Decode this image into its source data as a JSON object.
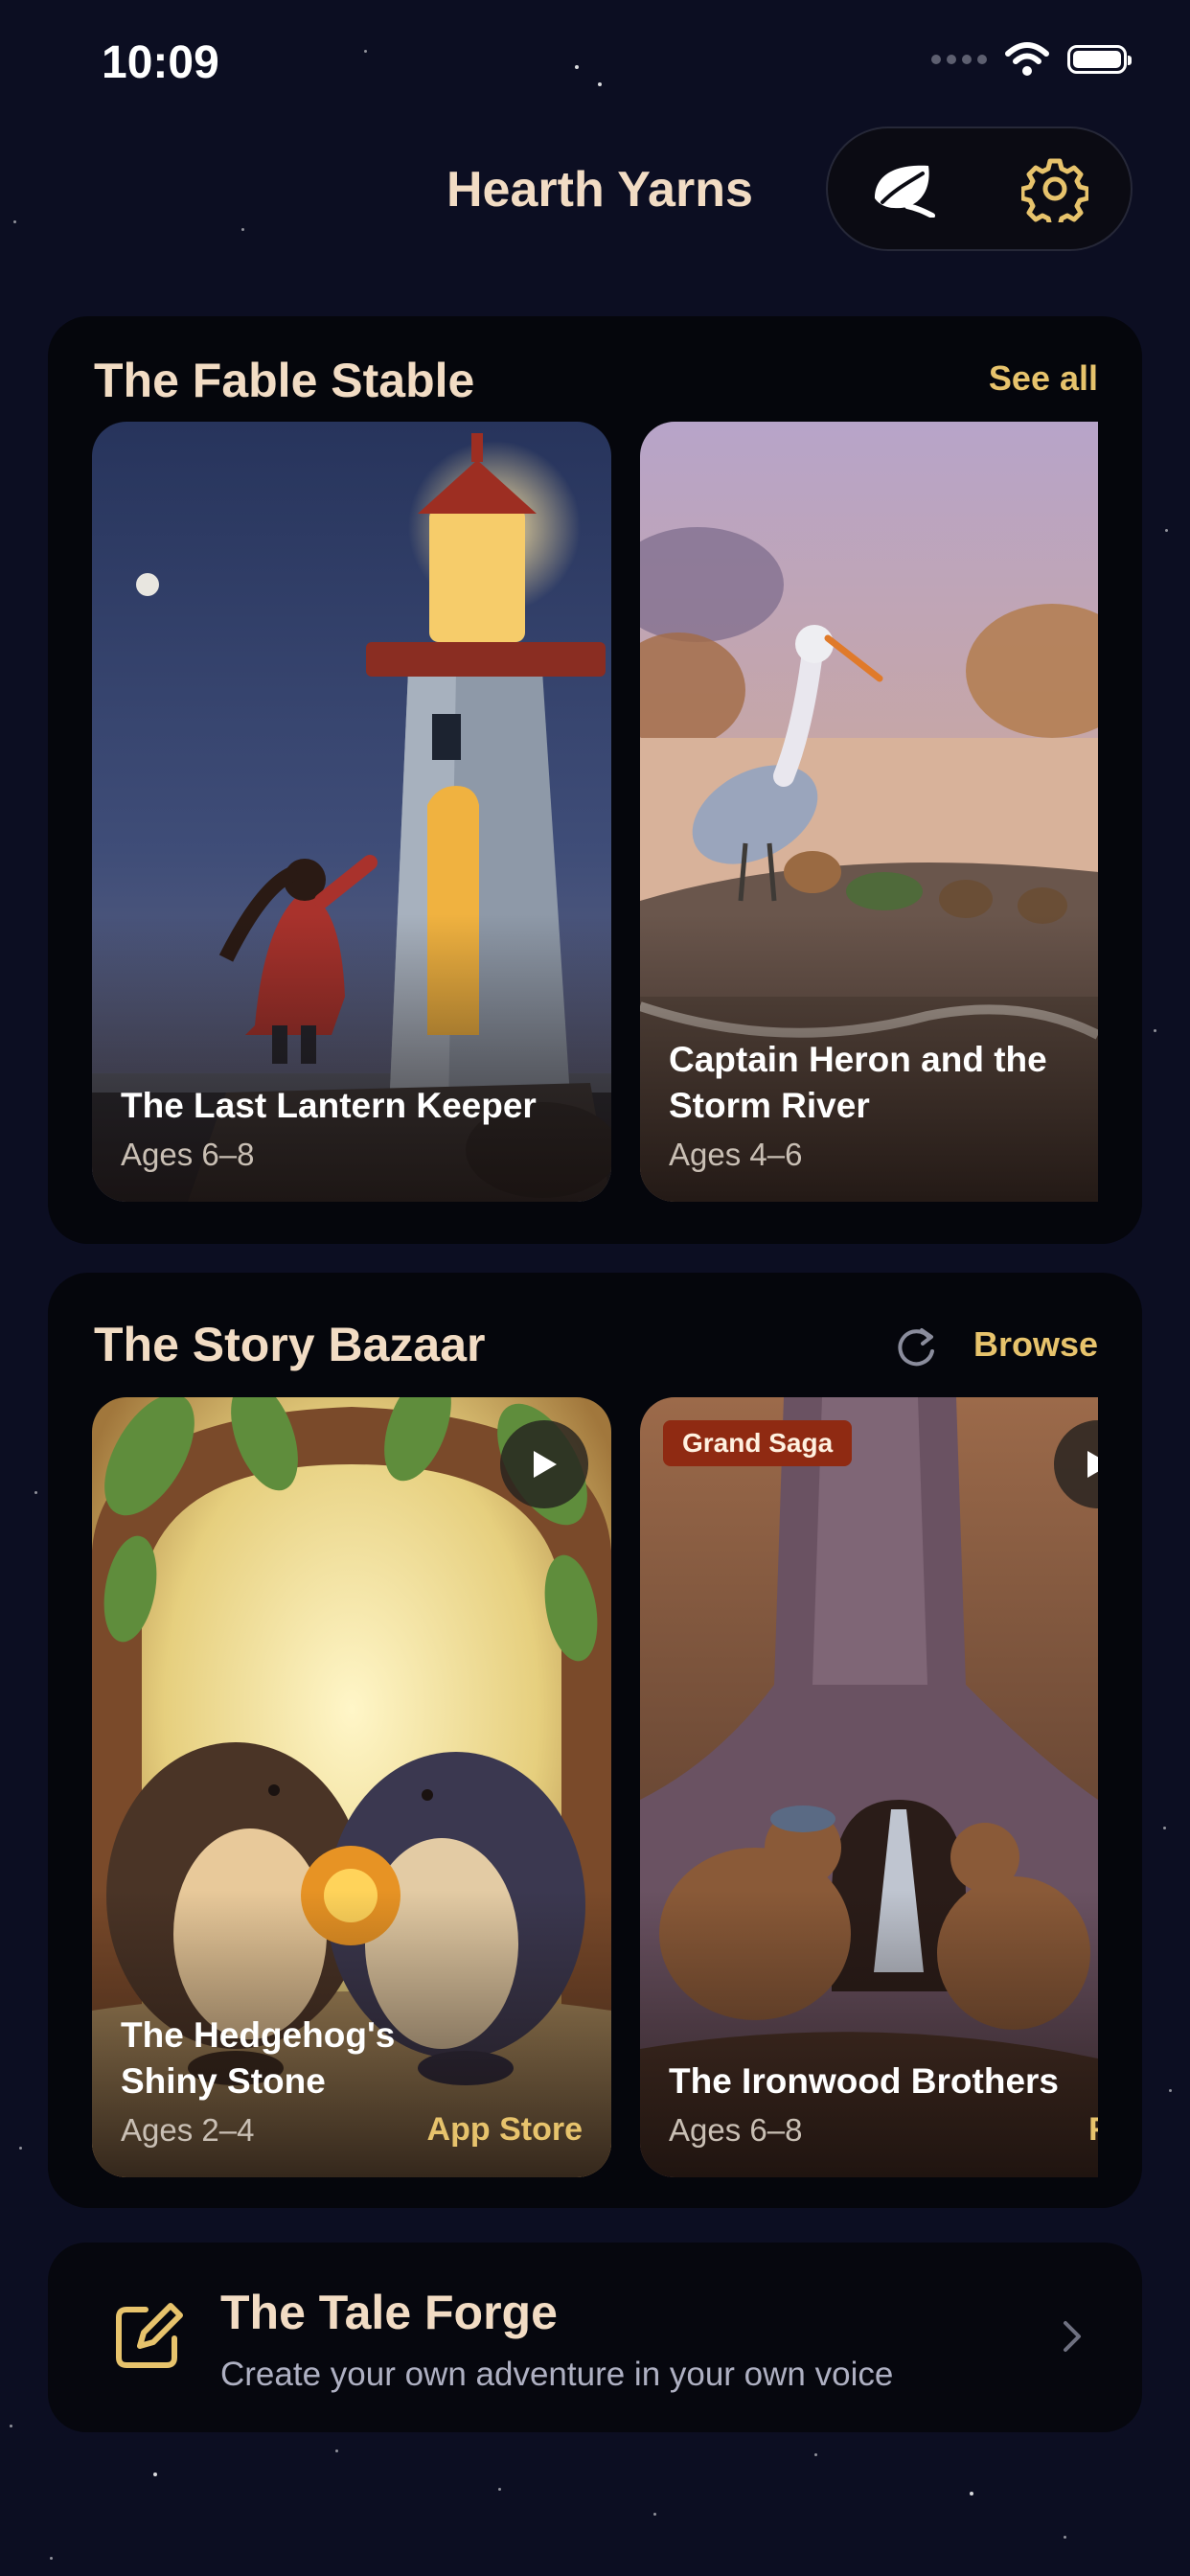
{
  "status_bar": {
    "time": "10:09"
  },
  "header": {
    "title": "Hearth Yarns",
    "icons": [
      "leaf-icon",
      "gear-icon"
    ]
  },
  "fable_stable": {
    "title": "The Fable Stable",
    "see_all": "See all",
    "books": [
      {
        "title": "The Last Lantern Keeper",
        "age": "Ages 6–8"
      },
      {
        "title": "Captain Heron and the Storm River",
        "age": "Ages 4–6"
      }
    ]
  },
  "story_bazaar": {
    "title": "The Story Bazaar",
    "browse": "Browse",
    "books": [
      {
        "title": "The Hedgehog's Shiny Stone",
        "age": "Ages 2–4",
        "store": "App Store"
      },
      {
        "title": "The Ironwood Brothers",
        "age": "Ages 6–8",
        "badge": "Grand Saga",
        "store": "Free"
      }
    ]
  },
  "tale_forge": {
    "title": "The Tale Forge",
    "subtitle": "Create your own adventure in your own voice"
  },
  "colors": {
    "background": "#0c0e22",
    "accent": "#e7c36c",
    "text": "#f2dcc4",
    "badge": "#8f2a12"
  }
}
